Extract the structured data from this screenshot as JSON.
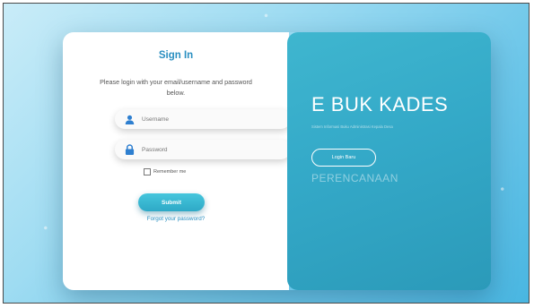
{
  "login": {
    "title": "Sign In",
    "subtitle": "Please login with your email/username and password below.",
    "username_placeholder": "Username",
    "password_placeholder": "Password",
    "remember_label": "Remember me",
    "submit_label": "Submit",
    "forgot_label": "Forgot your password?"
  },
  "hero": {
    "brand": "E BUK KADES",
    "tagline": "Sistem Informasi Buku Administrasi Kepala Desa",
    "button_label": "Login Baru",
    "section": "PERENCANAAN"
  },
  "icons": {
    "user": "user-icon",
    "lock": "lock-icon"
  },
  "colors": {
    "accent": "#2a8fc1",
    "panel": "#34a9c8",
    "button": "#3bbbd6"
  }
}
